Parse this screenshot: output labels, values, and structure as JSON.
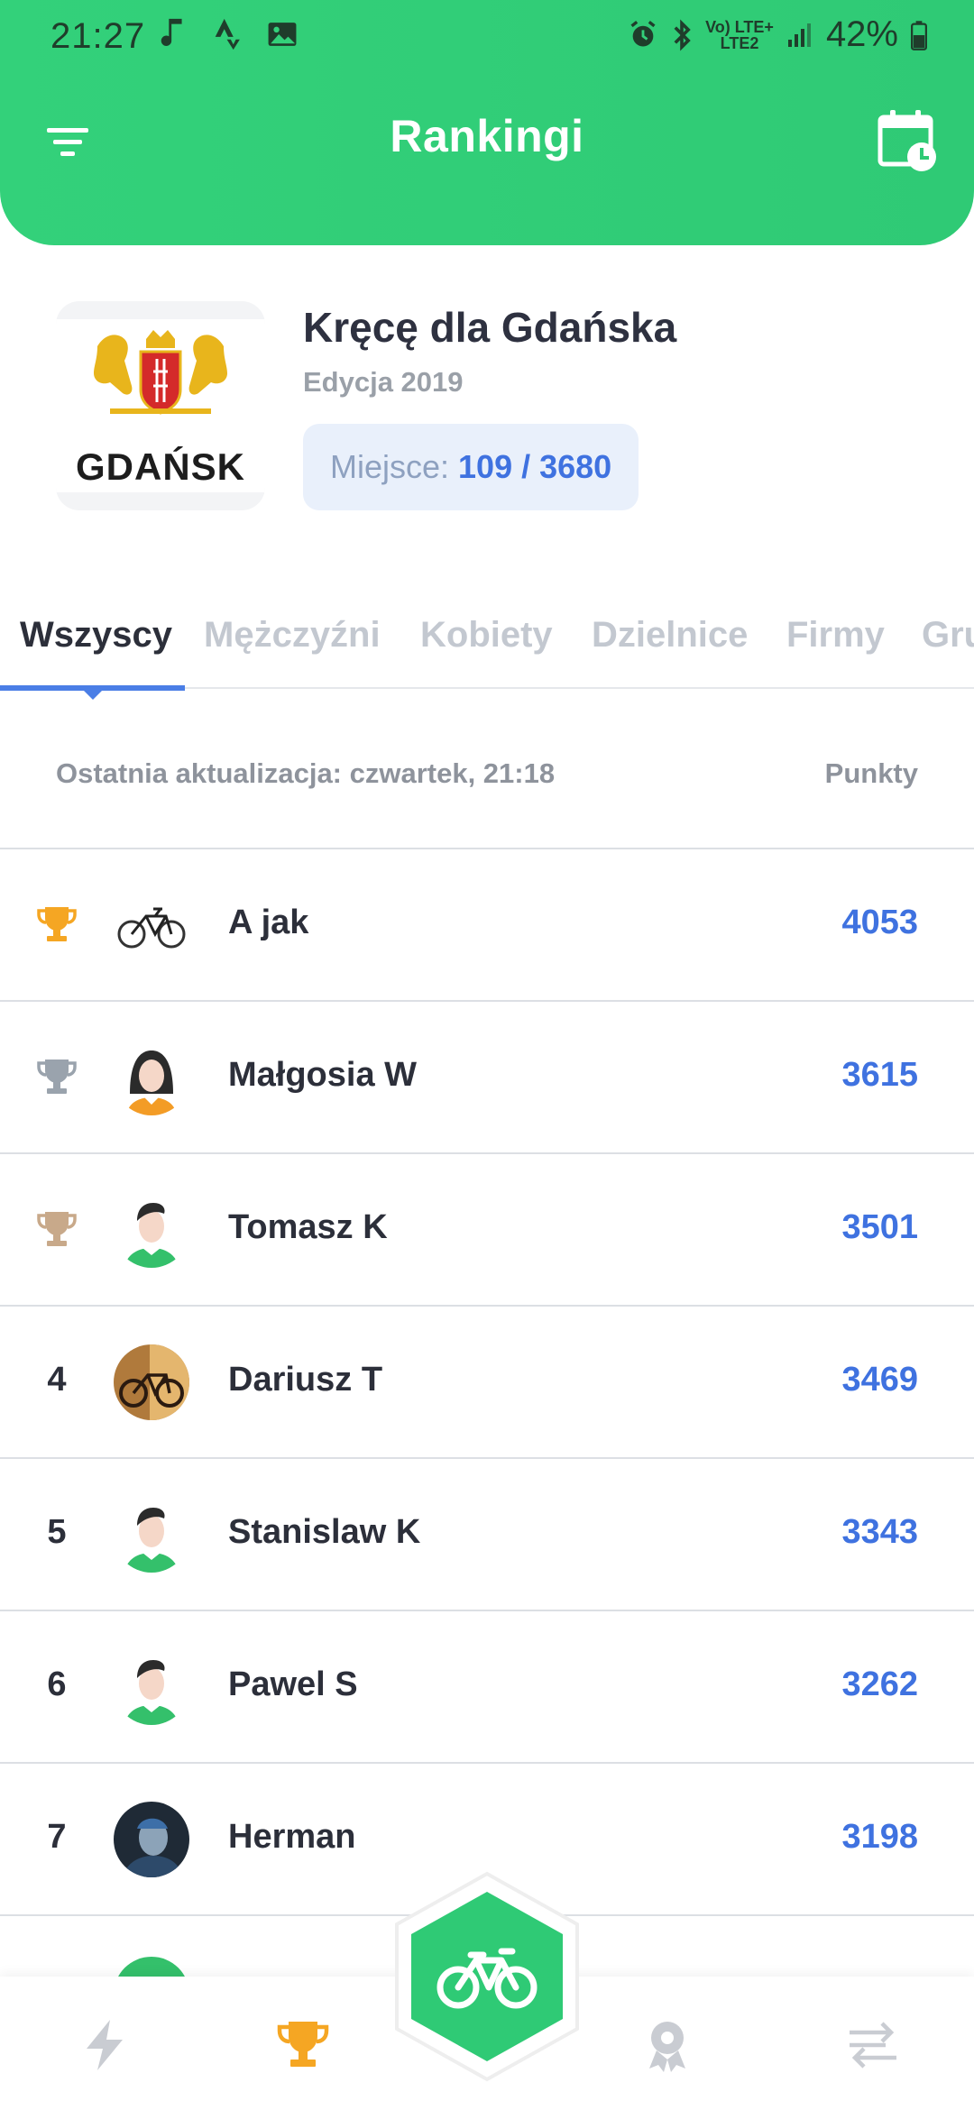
{
  "status_bar": {
    "time": "21:27",
    "battery": "42%",
    "network_top": "Vo) LTE+",
    "network_bottom": "LTE2"
  },
  "header": {
    "title": "Rankingi",
    "filter_icon": "filter-icon",
    "calendar_icon": "calendar-clock-icon"
  },
  "event": {
    "logo_text": "GDAŃSK",
    "title": "Kręcę dla Gdańska",
    "edition": "Edycja 2019",
    "place_label": "Miejsce:",
    "place_value": "109 / 3680"
  },
  "tabs": [
    {
      "label": "Wszyscy",
      "active": true
    },
    {
      "label": "Mężczyźni",
      "active": false
    },
    {
      "label": "Kobiety",
      "active": false
    },
    {
      "label": "Dzielnice",
      "active": false
    },
    {
      "label": "Firmy",
      "active": false
    },
    {
      "label": "Gru",
      "active": false
    }
  ],
  "info": {
    "updated": "Ostatnia aktualizacja: czwartek, 21:18",
    "points_header": "Punkty"
  },
  "ranking": [
    {
      "position": "",
      "trophy": "gold",
      "avatar": "bike-photo",
      "name": "A jak",
      "points": "4053"
    },
    {
      "position": "",
      "trophy": "silver",
      "avatar": "female-avatar",
      "name": "Małgosia W",
      "points": "3615"
    },
    {
      "position": "",
      "trophy": "bronze",
      "avatar": "male-avatar",
      "name": "Tomasz K",
      "points": "3501"
    },
    {
      "position": "4",
      "trophy": "",
      "avatar": "bike-photo-round",
      "name": "Dariusz T",
      "points": "3469"
    },
    {
      "position": "5",
      "trophy": "",
      "avatar": "male-avatar",
      "name": "Stanislaw K",
      "points": "3343"
    },
    {
      "position": "6",
      "trophy": "",
      "avatar": "male-avatar",
      "name": "Pawel S",
      "points": "3262"
    },
    {
      "position": "7",
      "trophy": "",
      "avatar": "photo-avatar",
      "name": "Herman",
      "points": "3198"
    }
  ],
  "colors": {
    "header_green": "#33d17a",
    "accent_blue": "#3f72e0",
    "trophy_gold": "#f5a623",
    "trophy_silver": "#9aa3ad",
    "trophy_bronze": "#c8a98a"
  },
  "bottom_nav": {
    "items": [
      "lightning-icon",
      "trophy-icon",
      "bike-icon",
      "medal-icon",
      "arrows-icon"
    ],
    "active": "trophy-icon"
  }
}
